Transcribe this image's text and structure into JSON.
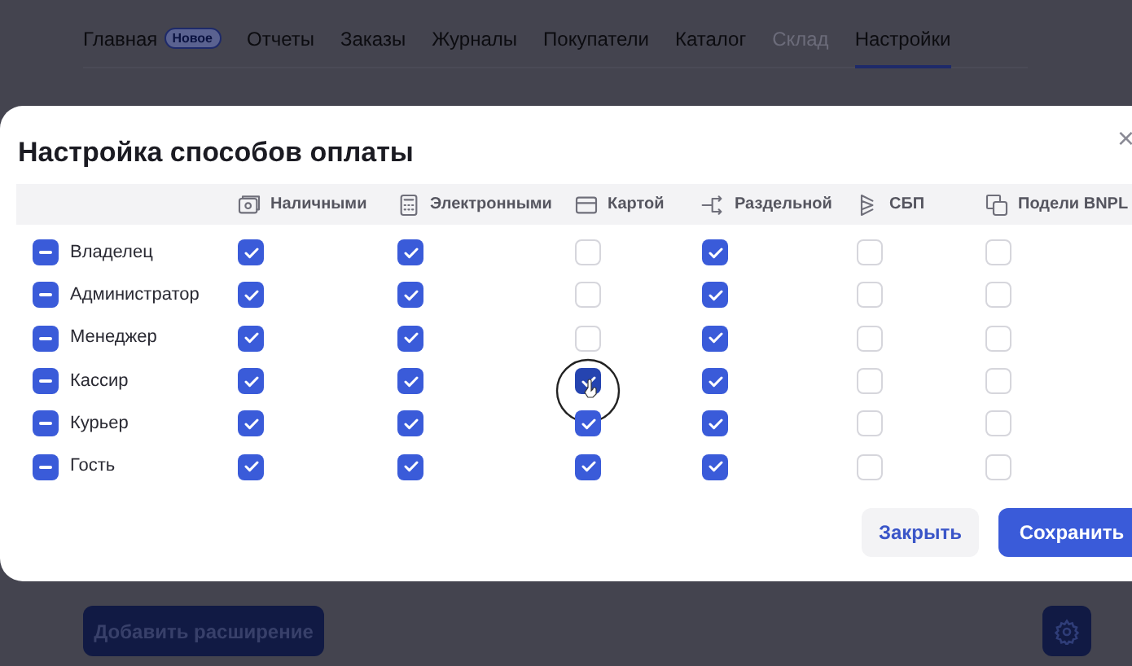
{
  "nav": {
    "tabs": [
      {
        "label": "Главная",
        "badge": "Новое",
        "selected": false,
        "disabled": false
      },
      {
        "label": "Отчеты",
        "selected": false,
        "disabled": false
      },
      {
        "label": "Заказы",
        "selected": false,
        "disabled": false
      },
      {
        "label": "Журналы",
        "selected": false,
        "disabled": false
      },
      {
        "label": "Покупатели",
        "selected": false,
        "disabled": false
      },
      {
        "label": "Каталог",
        "selected": false,
        "disabled": false
      },
      {
        "label": "Склад",
        "selected": false,
        "disabled": true
      },
      {
        "label": "Настройки",
        "selected": true,
        "disabled": false
      }
    ]
  },
  "page": {
    "add_button": "Добавить расширение"
  },
  "dialog": {
    "title": "Настройка способов оплаты",
    "close": "×",
    "columns": [
      {
        "label": "Наличными",
        "kind": "cash"
      },
      {
        "label": "Электронными",
        "kind": "calculator"
      },
      {
        "label": "Картой",
        "kind": "card"
      },
      {
        "label": "Раздельной",
        "kind": "split"
      },
      {
        "label": "СБП",
        "kind": "sbp"
      },
      {
        "label": "Подели BNPL",
        "kind": "copy"
      }
    ],
    "rows": [
      {
        "role": "Владелец",
        "checks": [
          true,
          true,
          false,
          true,
          false,
          false
        ],
        "pressed": false
      },
      {
        "role": "Администратор",
        "checks": [
          true,
          true,
          false,
          true,
          false,
          false
        ],
        "pressed": false
      },
      {
        "role": "Менеджер",
        "checks": [
          true,
          true,
          false,
          true,
          false,
          false
        ],
        "pressed": false
      },
      {
        "role": "Кассир",
        "checks": [
          true,
          true,
          true,
          true,
          false,
          false
        ],
        "pressed": true
      },
      {
        "role": "Курьер",
        "checks": [
          true,
          true,
          true,
          true,
          false,
          false
        ],
        "pressed": false
      },
      {
        "role": "Гость",
        "checks": [
          true,
          true,
          true,
          true,
          false,
          false
        ],
        "pressed": false
      }
    ],
    "buttons": [
      {
        "label": "Закрыть",
        "kind": "secondary"
      },
      {
        "label": "Сохранить",
        "kind": "primary"
      }
    ]
  }
}
